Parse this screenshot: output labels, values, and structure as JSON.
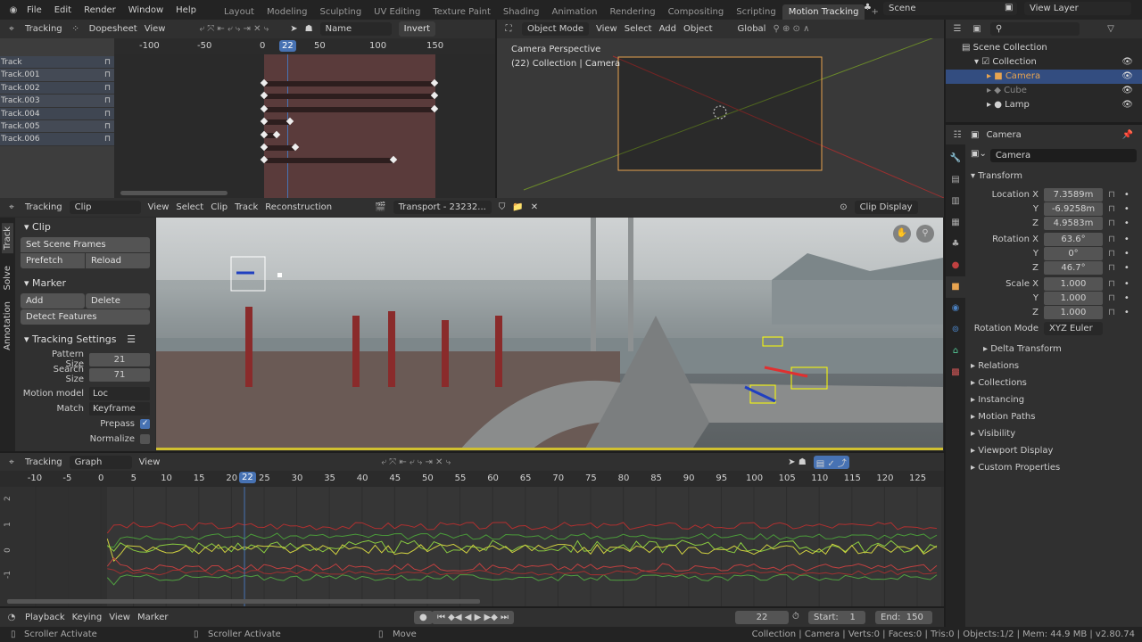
{
  "topbar": {
    "menus": [
      "File",
      "Edit",
      "Render",
      "Window",
      "Help"
    ],
    "workspaces": [
      "Layout",
      "Modeling",
      "Sculpting",
      "UV Editing",
      "Texture Paint",
      "Shading",
      "Animation",
      "Rendering",
      "Compositing",
      "Scripting",
      "Motion Tracking"
    ],
    "active_workspace": "Motion Tracking",
    "scene": "Scene",
    "view_layer": "View Layer"
  },
  "dopesheet": {
    "mode": "Tracking",
    "view_type": "Dopesheet",
    "view": "View",
    "sort": "Name",
    "invert": "Invert",
    "ruler": [
      "-100",
      "-50",
      "0",
      "22",
      "50",
      "100",
      "150"
    ],
    "tracks": [
      "Track",
      "Track.001",
      "Track.002",
      "Track.003",
      "Track.004",
      "Track.005",
      "Track.006"
    ]
  },
  "viewport": {
    "mode": "Object Mode",
    "menus": [
      "View",
      "Select",
      "Add",
      "Object"
    ],
    "orientation": "Global",
    "info1": "Camera Perspective",
    "info2": "(22) Collection | Camera"
  },
  "outliner": {
    "root": "Scene Collection",
    "collection": "Collection",
    "items": [
      "Camera",
      "Cube",
      "Lamp"
    ]
  },
  "properties": {
    "header": "Camera",
    "object_name": "Camera",
    "section": "Transform",
    "location": {
      "label": "Location X",
      "x": "7.3589m",
      "y": "-6.9258m",
      "z": "4.9583m"
    },
    "rotation": {
      "label": "Rotation X",
      "x": "63.6°",
      "y": "0°",
      "z": "46.7°"
    },
    "scale": {
      "label": "Scale X",
      "x": "1.000",
      "y": "1.000",
      "z": "1.000"
    },
    "axis_y": "Y",
    "axis_z": "Z",
    "rotation_mode_label": "Rotation Mode",
    "rotation_mode": "XYZ Euler",
    "subsections": [
      "Delta Transform",
      "Relations",
      "Collections",
      "Instancing",
      "Motion Paths",
      "Visibility",
      "Viewport Display",
      "Custom Properties"
    ]
  },
  "clip": {
    "mode": "Tracking",
    "view_type": "Clip",
    "menus": [
      "View",
      "Select",
      "Clip",
      "Track",
      "Reconstruction"
    ],
    "clip_name": "Transport - 23232...",
    "display": "Clip Display",
    "side_tabs": [
      "Track",
      "Solve",
      "Annotation"
    ],
    "panel_clip": {
      "title": "Clip",
      "set_scene_frames": "Set Scene Frames",
      "prefetch": "Prefetch",
      "reload": "Reload"
    },
    "panel_marker": {
      "title": "Marker",
      "add": "Add",
      "delete": "Delete",
      "detect": "Detect Features"
    },
    "panel_tracking": {
      "title": "Tracking Settings",
      "pattern_label": "Pattern Size",
      "pattern": "21",
      "search_label": "Search Size",
      "search": "71",
      "motion_label": "Motion model",
      "motion": "Loc",
      "match_label": "Match",
      "match": "Keyframe",
      "prepass": "Prepass",
      "prepass_checked": true,
      "normalize": "Normalize",
      "normalize_checked": false
    }
  },
  "graph": {
    "mode": "Tracking",
    "view_type": "Graph",
    "view": "View",
    "ruler": [
      "-10",
      "-5",
      "0",
      "5",
      "10",
      "15",
      "20",
      "22",
      "25",
      "30",
      "35",
      "40",
      "45",
      "50",
      "55",
      "60",
      "65",
      "70",
      "75",
      "80",
      "85",
      "90",
      "95",
      "100",
      "105",
      "110",
      "115",
      "120",
      "125"
    ],
    "yticks": [
      "2",
      "1",
      "0",
      "-1"
    ]
  },
  "timeline": {
    "menus": [
      "Playback",
      "Keying",
      "View",
      "Marker"
    ],
    "current": "22",
    "start_label": "Start:",
    "start": "1",
    "end_label": "End:",
    "end": "150"
  },
  "status": {
    "left": "Scroller Activate",
    "mid": "Scroller Activate",
    "move": "Move",
    "info": "Collection | Camera | Verts:0 | Faces:0 | Tris:0 | Objects:1/2 | Mem: 44.9 MB | v2.80.74"
  },
  "colors": {
    "accent": "#4772b3",
    "active_orange": "#e8a450",
    "track_bg": "#5a3b3b"
  }
}
